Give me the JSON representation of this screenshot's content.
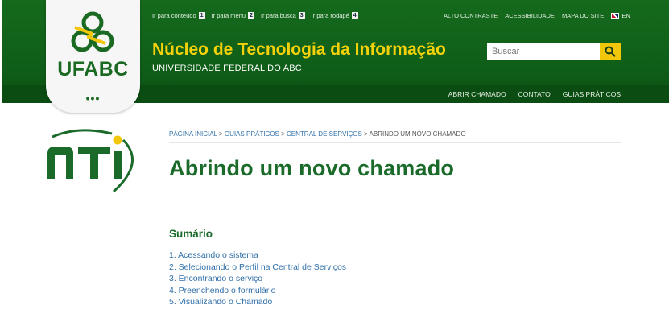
{
  "accessibility_links": [
    {
      "label": "Ir para conteúdo",
      "key": "1"
    },
    {
      "label": "Ir para menu",
      "key": "2"
    },
    {
      "label": "Ir para busca",
      "key": "3"
    },
    {
      "label": "Ir para rodapé",
      "key": "4"
    }
  ],
  "utility_links": {
    "contrast": "ALTO CONTRASTE",
    "accessibility": "ACESSIBILIDADE",
    "sitemap": "MAPA DO SITE",
    "language": "EN"
  },
  "logo": {
    "text": "UFABC",
    "dots": "•••"
  },
  "site": {
    "title": "Núcleo de Tecnologia da Informação",
    "subtitle": "UNIVERSIDADE FEDERAL DO ABC"
  },
  "search": {
    "placeholder": "Buscar"
  },
  "main_nav": [
    "ABRIR CHAMADO",
    "CONTATO",
    "GUIAS PRÁTICOS"
  ],
  "breadcrumb": {
    "items": [
      "PÁGINA INICIAL",
      "GUIAS PRÁTICOS",
      "CENTRAL DE SERVIÇOS"
    ],
    "separator": ">",
    "current": "ABRINDO UM NOVO CHAMADO"
  },
  "page": {
    "title": "Abrindo um novo chamado",
    "summary_heading": "Sumário",
    "toc": [
      "1. Acessando o sistema",
      "2. Selecionando o Perfil na Central de Serviços",
      "3. Encontrando o serviço",
      "4. Preenchendo o formulário",
      "5. Visualizando o Chamado"
    ]
  },
  "colors": {
    "header_green": "#156a1c",
    "accent_yellow": "#f5d10a",
    "title_green": "#1a6a2a",
    "link_blue": "#2f6fa8"
  },
  "icons": [
    "ufabc-logo-icon",
    "search-icon",
    "uk-flag-icon",
    "nti-logo-icon"
  ]
}
